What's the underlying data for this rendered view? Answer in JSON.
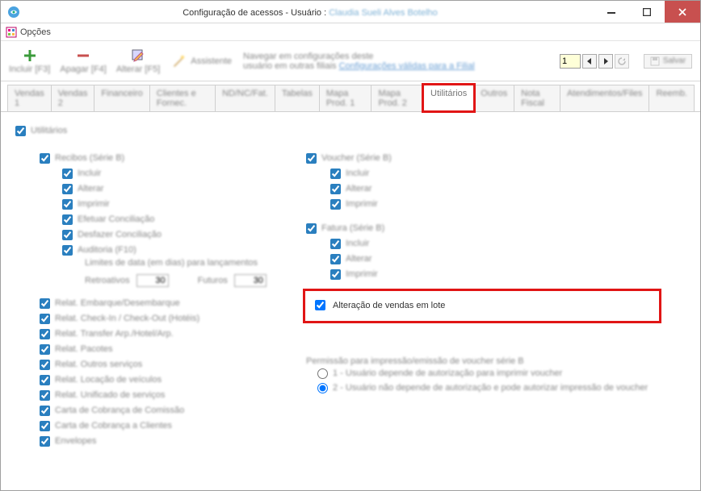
{
  "window": {
    "title_prefix": "Configuração de acessos - Usuário : ",
    "user_name": "Claudia Sueli  Alves Botelho"
  },
  "menu": {
    "opcoes": "Opções"
  },
  "toolbar": {
    "incluir": "Incluir [F3]",
    "apagar": "Apagar [F4]",
    "alterar": "Alterar [F5]",
    "assistente": "Assistente",
    "nav_line1": "Navegar em configurações deste",
    "nav_line2a": "usuário em outras filiais ",
    "nav_link": "Configurações válidas para a Filial",
    "filial_value": "1",
    "salvar": "Salvar"
  },
  "tabs": {
    "t1": "Vendas 1",
    "t2": "Vendas 2",
    "t3": "Financeiro",
    "t4": "Clientes e Fornec.",
    "t5": "ND/NC/Fat.",
    "t6": "Tabelas",
    "t7": "Mapa Prod. 1",
    "t8": "Mapa Prod. 2",
    "t9": "Utilitários",
    "t10": "Outros",
    "t11": "Nota Fiscal",
    "t12": "Atendimentos/Files",
    "t13": "Reemb."
  },
  "left": {
    "utilitarios": "Utilitários",
    "recibos": "Recibos (Série B)",
    "incluir": "Incluir",
    "alterar": "Alterar",
    "imprimir": "Imprimir",
    "efetuar": "Efetuar Conciliação",
    "desfazer": "Desfazer Conciliação",
    "auditoria": "Auditoria (F10)",
    "limites": "Limites de data (em dias) para lançamentos",
    "retroativos": "Retroativos",
    "retro_val": "30",
    "futuros": "Futuros",
    "fut_val": "30",
    "rel1": "Relat. Embarque/Desembarque",
    "rel2": "Relat. Check-In / Check-Out (Hotéis)",
    "rel3": "Relat. Transfer Arp./Hotel/Arp.",
    "rel4": "Relat. Pacotes",
    "rel5": "Relat. Outros serviços",
    "rel6": "Relat. Locação de veículos",
    "rel7": "Relat. Unificado de serviços",
    "rel8": "Carta de Cobrança de Comissão",
    "rel9": "Carta de Cobrança a Clientes",
    "rel10": "Envelopes"
  },
  "right": {
    "voucher": "Voucher (Série B)",
    "incluir": "Incluir",
    "alterar": "Alterar",
    "imprimir": "Imprimir",
    "fatura": "Fatura (Série B)",
    "alt_lote": "Alteração de vendas em lote",
    "perm_title": "Permissão para impressão/emissão de voucher série B",
    "perm_opt1": "1 - Usuário depende de autorização para imprimir voucher",
    "perm_opt2": "2 - Usuário não depende de autorização e pode autorizar impressão de voucher"
  }
}
